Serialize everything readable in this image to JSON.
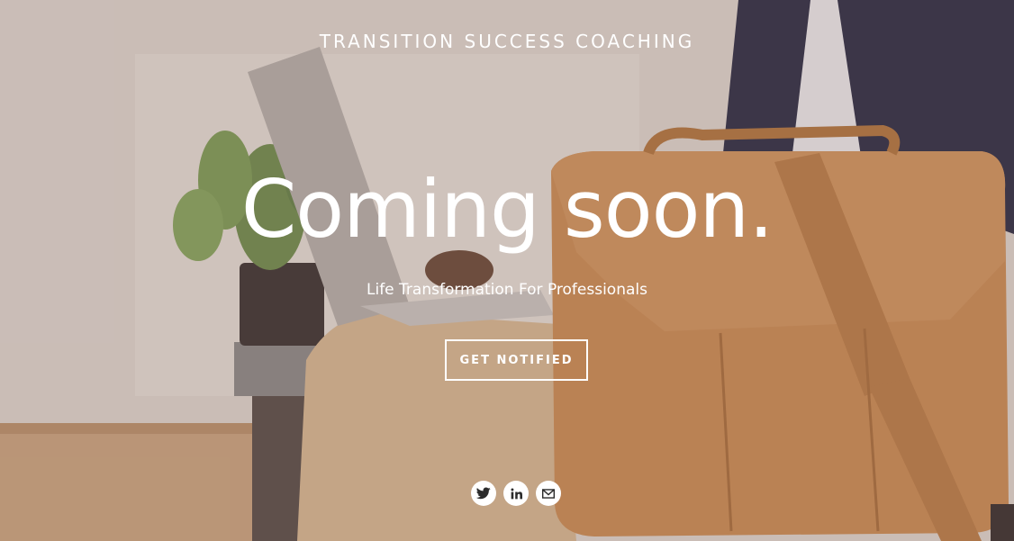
{
  "header": {
    "site_title": "TRANSITION SUCCESS COACHING"
  },
  "hero": {
    "headline": "Coming soon.",
    "subtitle": "Life Transformation For Professionals",
    "cta_label": "GET NOTIFIED"
  },
  "social": {
    "links": [
      {
        "name": "twitter",
        "icon": "twitter-icon"
      },
      {
        "name": "linkedin",
        "icon": "linkedin-icon"
      },
      {
        "name": "email",
        "icon": "mail-icon"
      }
    ]
  },
  "colors": {
    "text": "#ffffff",
    "icon_glyph": "#2b2b2b",
    "bag_leather": "#c98a55",
    "overlay": "rgba(120,95,85,0.18)"
  }
}
